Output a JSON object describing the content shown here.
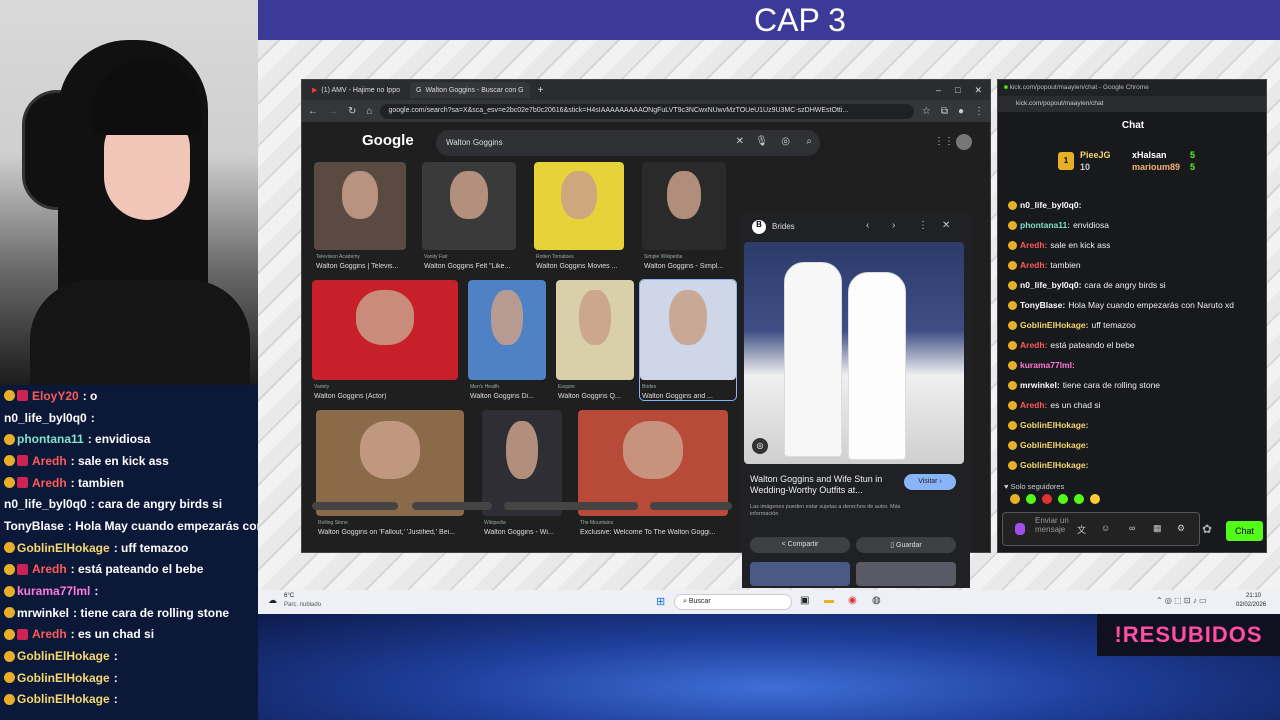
{
  "stream": {
    "title": "CAP 3",
    "watermark": "!RESUBIDOS"
  },
  "left_chat": [
    {
      "user": "EloyY20",
      "color": "#ff5a5a",
      "msg": ": o",
      "badges": 2
    },
    {
      "user": "n0_life_byl0q0",
      "color": "#ffffff",
      "msg": ":",
      "badges": 0
    },
    {
      "user": "phontana11",
      "color": "#7fe3c8",
      "msg": ": envidiosa",
      "badges": 1
    },
    {
      "user": "Aredh",
      "color": "#ff5a5a",
      "msg": ": sale en kick ass",
      "badges": 2
    },
    {
      "user": "Aredh",
      "color": "#ff5a5a",
      "msg": ": tambien",
      "badges": 2
    },
    {
      "user": "n0_life_byl0q0",
      "color": "#ffffff",
      "msg": ": cara de angry birds si",
      "badges": 0
    },
    {
      "user": "TonyBlase",
      "color": "#ffffff",
      "msg": ": Hola May cuando empezarás con N",
      "badges": 0
    },
    {
      "user": "GoblinElHokage",
      "color": "#f5d76e",
      "msg": ": uff temazoo",
      "badges": 1
    },
    {
      "user": "Aredh",
      "color": "#ff5a5a",
      "msg": ": está pateando el bebe",
      "badges": 2
    },
    {
      "user": "kurama77lml",
      "color": "#ff7ad9",
      "msg": ":",
      "badges": 1
    },
    {
      "user": "mrwinkel",
      "color": "#ffffff",
      "msg": ": tiene cara de rolling stone",
      "badges": 1
    },
    {
      "user": "Aredh",
      "color": "#ff5a5a",
      "msg": ": es un chad si",
      "badges": 2
    },
    {
      "user": "GoblinElHokage",
      "color": "#f5d76e",
      "msg": ":",
      "badges": 1
    },
    {
      "user": "GoblinElHokage",
      "color": "#f5d76e",
      "msg": ":",
      "badges": 1
    },
    {
      "user": "GoblinElHokage",
      "color": "#f5d76e",
      "msg": ":",
      "badges": 1
    }
  ],
  "browser": {
    "tabs": [
      {
        "label": "(1) AMV - Hajime no Ippo"
      },
      {
        "label": "Walton Goggins - Buscar con G"
      }
    ],
    "url": "google.com/search?sa=X&sca_esv=e2bc02e7b0c20616&stick=H4sIAAAAAAAAAONgFuLVT9c3NCwxNUwvMzTOUeU1Uz9U3MC-szDHWEstOtti...",
    "logo": "Google",
    "query": "Walton Goggins"
  },
  "results": [
    {
      "src": "Television Academy",
      "cap": "Walton Goggins | Televis...",
      "color": "#5a4a42"
    },
    {
      "src": "Vanity Fair",
      "cap": "Walton Goggins Felt \"Like...",
      "color": "#3a3a3a"
    },
    {
      "src": "Rotten Tomatoes",
      "cap": "Walton Goggins Movies ...",
      "color": "#e7d23a"
    },
    {
      "src": "Simple Wikipedia",
      "cap": "Walton Goggins - Simpl...",
      "color": "#2a2a2a"
    },
    {
      "src": "Variety",
      "cap": "Walton Goggins (Actor)",
      "color": "#c8202a"
    },
    {
      "src": "Men's Health",
      "cap": "Walton Goggins Di...",
      "color": "#4f82c4"
    },
    {
      "src": "Esquire",
      "cap": "Walton Goggins Q...",
      "color": "#d9cfa8"
    },
    {
      "src": "Brides",
      "cap": "Walton Goggins and ...",
      "color": "#cfd6e8"
    },
    {
      "src": "Rolling Stone",
      "cap": "Walton Goggins on 'Fallout,' 'Justified,' Bei...",
      "color": "#8a6a48"
    },
    {
      "src": "Wikipedia",
      "cap": "Walton Goggins - Wi...",
      "color": "#2e2e34"
    },
    {
      "src": "The Mountains",
      "cap": "Exclusive: Welcome To The Walton Goggi...",
      "color": "#b84a3a"
    }
  ],
  "preview": {
    "source": "Brides",
    "title": "Walton Goggins and Wife Stun in Wedding-Worthy Outfits at...",
    "visit": "Visitar",
    "note": "Las imágenes pueden estar sujetas a derechos de autor. Más información",
    "share": "Compartir",
    "save": "Guardar"
  },
  "kick": {
    "window_title": "kick.com/popout/maaylen/chat - Google Chrome",
    "url": "kick.com/popout/maaylen/chat",
    "chat_label": "Chat",
    "top_gifters": [
      {
        "name": "PieeJG",
        "count": "10"
      },
      {
        "name": "xHalsan",
        "count": "5"
      },
      {
        "name": "marioum89",
        "count": "5"
      }
    ],
    "messages": [
      {
        "user": "n0_life_byl0q0:",
        "color": "#ffffff",
        "msg": ""
      },
      {
        "user": "phontana11:",
        "color": "#7fe3c8",
        "msg": "envidiosa"
      },
      {
        "user": "Aredh:",
        "color": "#ff5a5a",
        "msg": "sale en kick ass"
      },
      {
        "user": "Aredh:",
        "color": "#ff5a5a",
        "msg": "tambien"
      },
      {
        "user": "n0_life_byl0q0:",
        "color": "#ffffff",
        "msg": "cara de angry birds si"
      },
      {
        "user": "TonyBlase:",
        "color": "#ffffff",
        "msg": "Hola May cuando empezarás con Naruto xd"
      },
      {
        "user": "GoblinElHokage:",
        "color": "#f5d76e",
        "msg": "uff temazoo"
      },
      {
        "user": "Aredh:",
        "color": "#ff5a5a",
        "msg": "está pateando el bebe"
      },
      {
        "user": "kurama77lml:",
        "color": "#ff7ad9",
        "msg": ""
      },
      {
        "user": "mrwinkel:",
        "color": "#ffffff",
        "msg": "tiene cara de rolling stone"
      },
      {
        "user": "Aredh:",
        "color": "#ff5a5a",
        "msg": "es un chad si"
      },
      {
        "user": "GoblinElHokage:",
        "color": "#f5d76e",
        "msg": ""
      },
      {
        "user": "GoblinElHokage:",
        "color": "#f5d76e",
        "msg": ""
      },
      {
        "user": "GoblinElHokage:",
        "color": "#f5d76e",
        "msg": ""
      }
    ],
    "followers_only": "Solo seguidores",
    "input_placeholder": "Enviar un mensaje",
    "chat_button": "Chat"
  },
  "taskbar": {
    "weather_temp": "6°C",
    "weather_desc": "Parc. nublado",
    "search": "Buscar",
    "time": "21:10",
    "date": "02/02/2026"
  }
}
